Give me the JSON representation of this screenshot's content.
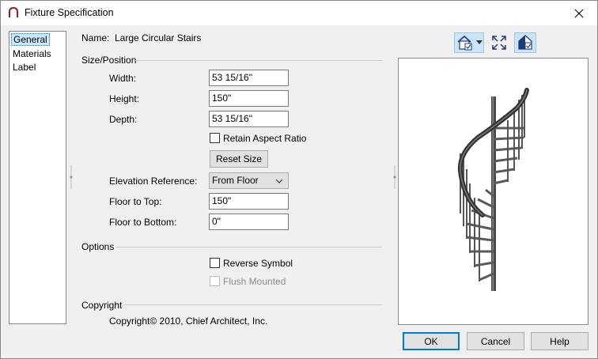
{
  "window": {
    "title": "Fixture Specification",
    "close_glyph": "✕"
  },
  "nav": {
    "items": [
      {
        "label": "General",
        "selected": true
      },
      {
        "label": "Materials",
        "selected": false
      },
      {
        "label": "Label",
        "selected": false
      }
    ]
  },
  "general": {
    "name_label": "Name:",
    "name_value": "Large Circular Stairs",
    "size_position": {
      "heading": "Size/Position",
      "width_label": "Width:",
      "width_value": "53 15/16\"",
      "height_label": "Height:",
      "height_value": "150\"",
      "depth_label": "Depth:",
      "depth_value": "53 15/16\"",
      "retain_aspect_label": "Retain Aspect Ratio",
      "retain_aspect_checked": false,
      "reset_size_label": "Reset Size",
      "elevation_reference_label": "Elevation Reference:",
      "elevation_reference_value": "From Floor",
      "floor_to_top_label": "Floor to Top:",
      "floor_to_top_value": "150\"",
      "floor_to_bottom_label": "Floor to Bottom:",
      "floor_to_bottom_value": "0\""
    },
    "options": {
      "heading": "Options",
      "reverse_symbol_label": "Reverse Symbol",
      "reverse_symbol_checked": false,
      "flush_mounted_label": "Flush Mounted",
      "flush_mounted_enabled": false
    },
    "copyright": {
      "heading": "Copyright",
      "text": "Copyright© 2010, Chief Architect, Inc."
    }
  },
  "preview_toolbar": {
    "buttons": [
      {
        "icon": "view-angle-icon",
        "has_dropdown": true,
        "active": true
      },
      {
        "icon": "fill-window-icon",
        "has_dropdown": false,
        "active": false
      },
      {
        "icon": "preview-mode-icon",
        "has_dropdown": false,
        "active": true
      }
    ]
  },
  "footer": {
    "ok_label": "OK",
    "cancel_label": "Cancel",
    "help_label": "Help"
  },
  "colors": {
    "accent": "#0078d7",
    "title_icon_red": "#9b1c1c",
    "stair_dark": "#3a3a3a",
    "stair_mid": "#6e6e6e"
  }
}
